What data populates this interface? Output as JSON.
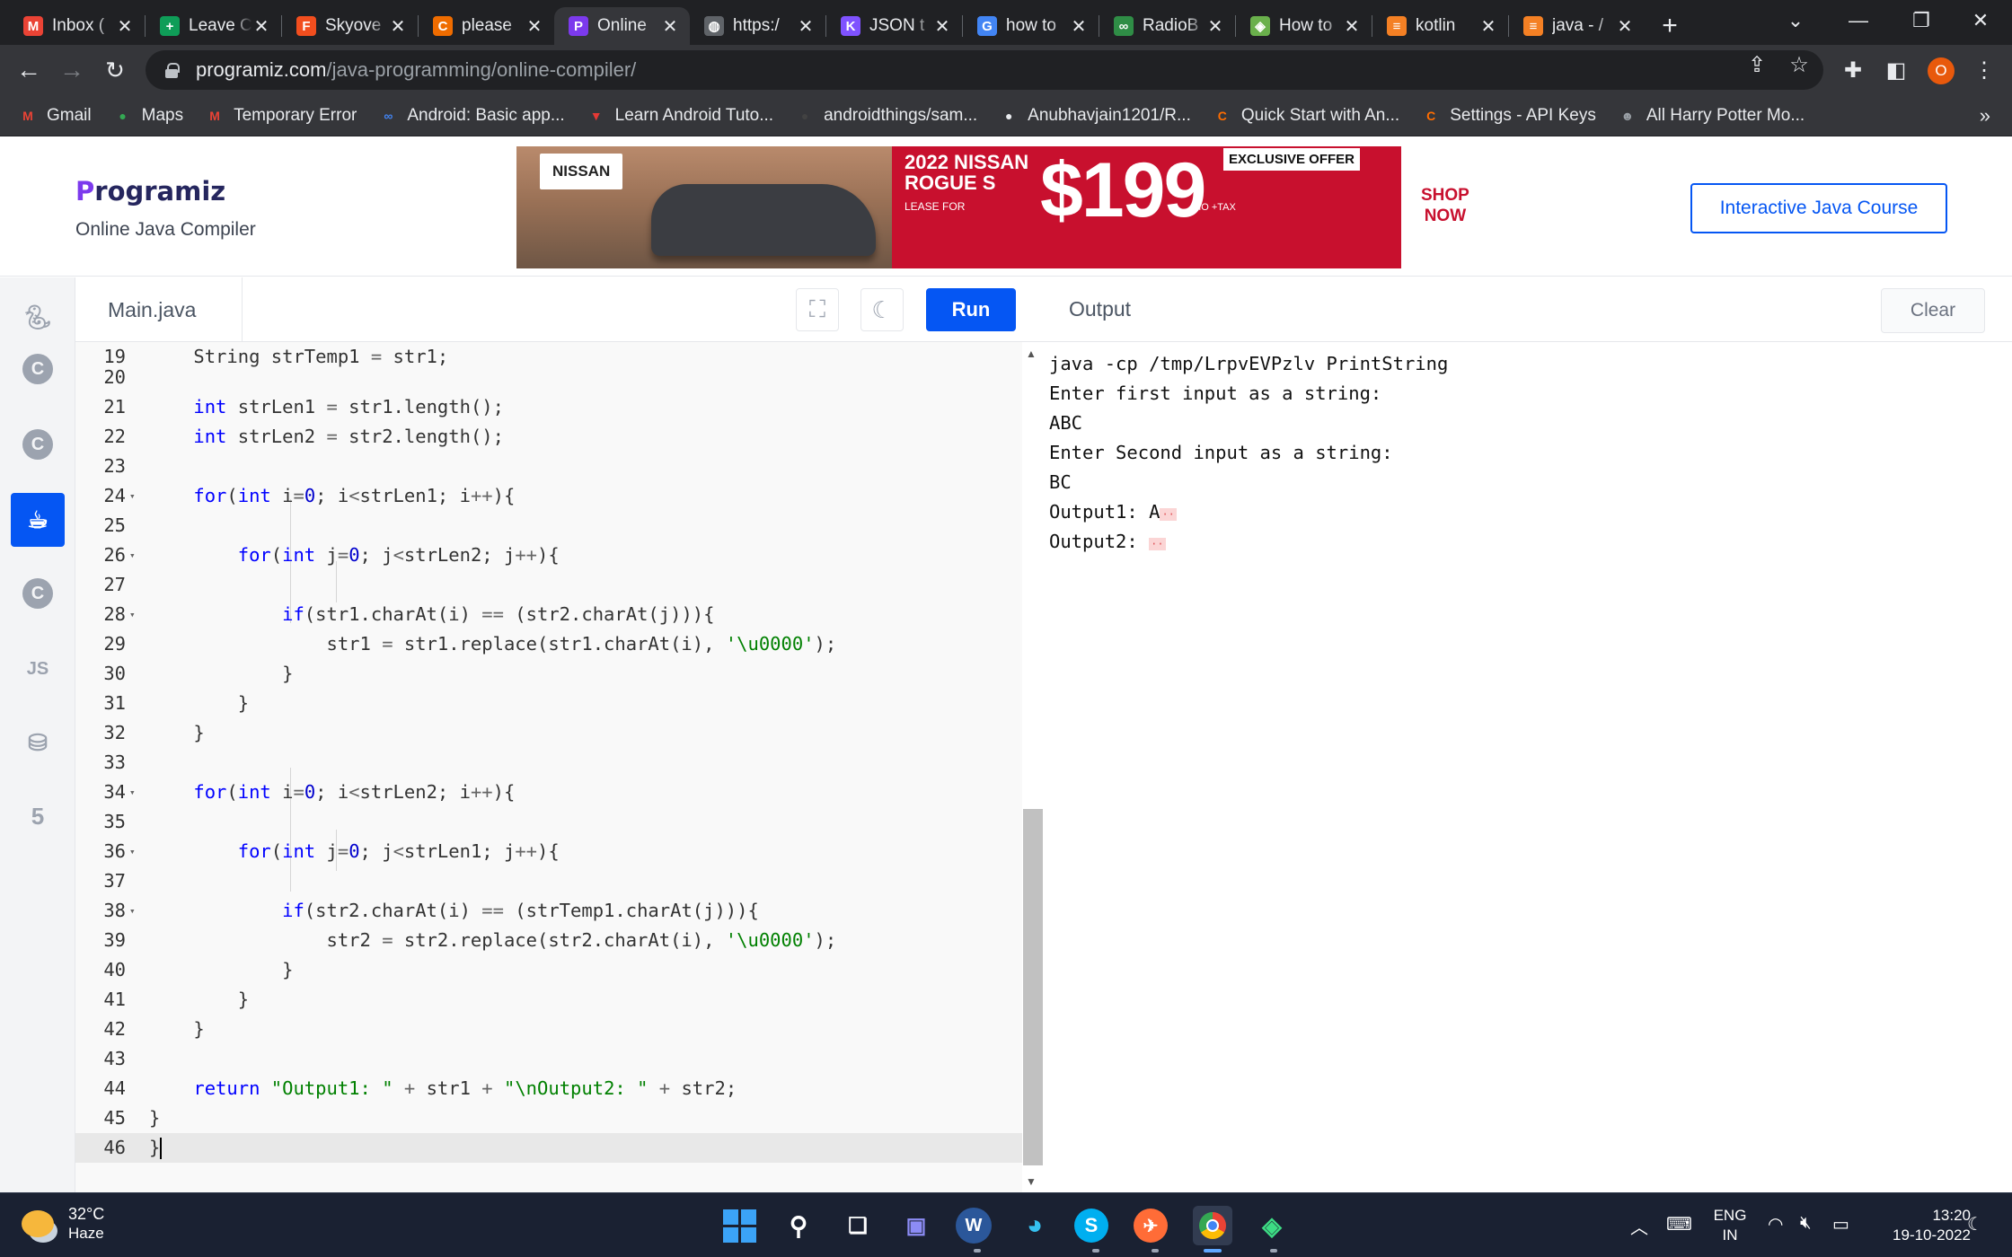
{
  "browser": {
    "tabs": [
      {
        "title": "Inbox (",
        "icon": "gmail-icon",
        "color": "#ea4335",
        "glyph": "M"
      },
      {
        "title": "Leave C",
        "icon": "sheets-icon",
        "color": "#0f9d58",
        "glyph": "+"
      },
      {
        "title": "Skyove",
        "icon": "figma-icon",
        "color": "#f24e1e",
        "glyph": "F"
      },
      {
        "title": "please",
        "icon": "c-icon",
        "color": "#ef6c00",
        "glyph": "C"
      },
      {
        "title": "Online",
        "icon": "programiz-icon",
        "color": "#7c3aed",
        "glyph": "P"
      },
      {
        "title": "https:/",
        "icon": "globe-icon",
        "color": "#5f6368",
        "glyph": "◍"
      },
      {
        "title": "JSON t",
        "icon": "kotlin-icon",
        "color": "#7f52ff",
        "glyph": "K"
      },
      {
        "title": "how to",
        "icon": "google-icon",
        "color": "#4285f4",
        "glyph": "G"
      },
      {
        "title": "RadioB",
        "icon": "gfg-icon",
        "color": "#2f8d46",
        "glyph": "∞"
      },
      {
        "title": "How to",
        "icon": "site-icon",
        "color": "#6ab04c",
        "glyph": "◈"
      },
      {
        "title": "kotlin",
        "icon": "stackoverflow-icon",
        "color": "#f48024",
        "glyph": "≡"
      },
      {
        "title": "java - /",
        "icon": "stackoverflow-icon",
        "color": "#f48024",
        "glyph": "≡"
      }
    ],
    "url_host": "programiz.com",
    "url_path": "/java-programming/online-compiler/",
    "profile_initial": "O",
    "bookmarks": [
      {
        "label": "Gmail",
        "color": "#ea4335",
        "glyph": "M"
      },
      {
        "label": "Maps",
        "color": "#34a853",
        "glyph": "●"
      },
      {
        "label": "Temporary Error",
        "color": "#ea4335",
        "glyph": "M"
      },
      {
        "label": "Android: Basic app...",
        "color": "#4285f4",
        "glyph": "∞"
      },
      {
        "label": "Learn Android Tuto...",
        "color": "#e53935",
        "glyph": "▼"
      },
      {
        "label": "androidthings/sam...",
        "color": "#424242",
        "glyph": "●"
      },
      {
        "label": "Anubhavjain1201/R...",
        "color": "#e8eaed",
        "glyph": "●"
      },
      {
        "label": "Quick Start with An...",
        "color": "#ff6d00",
        "glyph": "C"
      },
      {
        "label": "Settings - API Keys",
        "color": "#ff6d00",
        "glyph": "C"
      },
      {
        "label": "All Harry Potter Mo...",
        "color": "#9aa0a6",
        "glyph": "☻"
      }
    ]
  },
  "site": {
    "logo": "rogramiz",
    "logo_p": "P",
    "subtitle": "Online Java Compiler",
    "course_button": "Interactive Java Course",
    "ad": {
      "brand": "NISSAN",
      "model_line1": "2022 NISSAN",
      "model_line2": "ROGUE S",
      "lease_for": "LEASE FOR",
      "price": "$199",
      "per": "/MO +TAX",
      "offer": "EXCLUSIVE OFFER",
      "shop_line1": "SHOP",
      "shop_line2": "NOW"
    }
  },
  "editor": {
    "filename": "Main.java",
    "run_label": "Run"
  },
  "output": {
    "title": "Output",
    "clear_label": "Clear",
    "lines": [
      "java -cp /tmp/LrpvEVPzlv PrintString",
      "Enter first input as a string:",
      "ABC",
      "Enter Second input as a string:",
      "BC"
    ],
    "output1_label": "Output1: ",
    "output1_value": "A",
    "output2_label": "Output2: "
  },
  "taskbar": {
    "temperature": "32°C",
    "weather": "Haze",
    "lang_line1": "ENG",
    "lang_line2": "IN",
    "time": "13:20",
    "date": "19-10-2022"
  }
}
